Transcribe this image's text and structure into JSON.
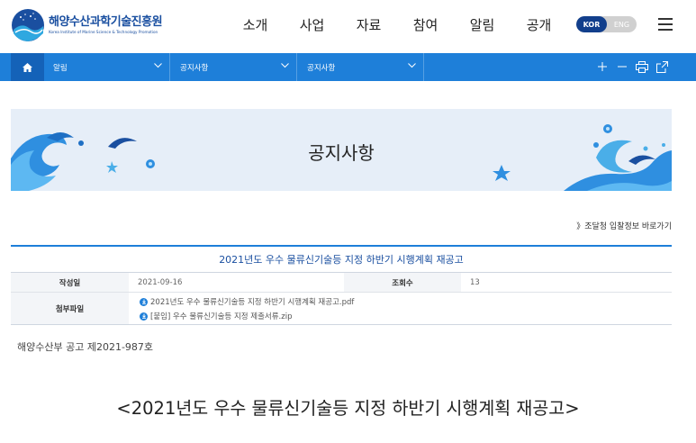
{
  "header": {
    "logo_ko": "해양수산과학기술진흥원",
    "logo_en": "Korea Institute of Marine Science & Technology Promotion",
    "nav": [
      {
        "label": "소개"
      },
      {
        "label": "사업"
      },
      {
        "label": "자료"
      },
      {
        "label": "참여"
      },
      {
        "label": "알림"
      },
      {
        "label": "공개"
      }
    ],
    "lang_kor": "KOR",
    "lang_eng": "ENG"
  },
  "location": {
    "crumbs": [
      {
        "label": "알림"
      },
      {
        "label": "공지사항"
      },
      {
        "label": "공지사항"
      }
    ]
  },
  "banner": {
    "title": "공지사항"
  },
  "bid_link": "》조달청 입찰정보 바로가기",
  "post": {
    "title": "2021년도 우수 물류신기술등 지정 하반기 시행계획 재공고",
    "date_label": "작성일",
    "date": "2021-09-16",
    "views_label": "조회수",
    "views": "13",
    "files_label": "첨부파일",
    "files": [
      {
        "name": "2021년도 우수 물류신기술등 지정 하반기 시행계획 재공고.pdf"
      },
      {
        "name": "[붙임] 우수 물류신기술등 지정 제출서류.zip"
      }
    ],
    "notice_no": "해양수산부 공고 제2021-987호",
    "heading": "<2021년도 우수 물류신기술등 지정 하반기 시행계획 재공고>"
  },
  "colors": {
    "primary": "#1e7fd9",
    "dark_blue": "#123f8c",
    "banner_bg": "#e6eef8"
  },
  "icons": [
    "home-icon",
    "chevron-down-icon",
    "plus-icon",
    "minus-icon",
    "print-icon",
    "share-icon",
    "download-icon",
    "hamburger-icon"
  ]
}
